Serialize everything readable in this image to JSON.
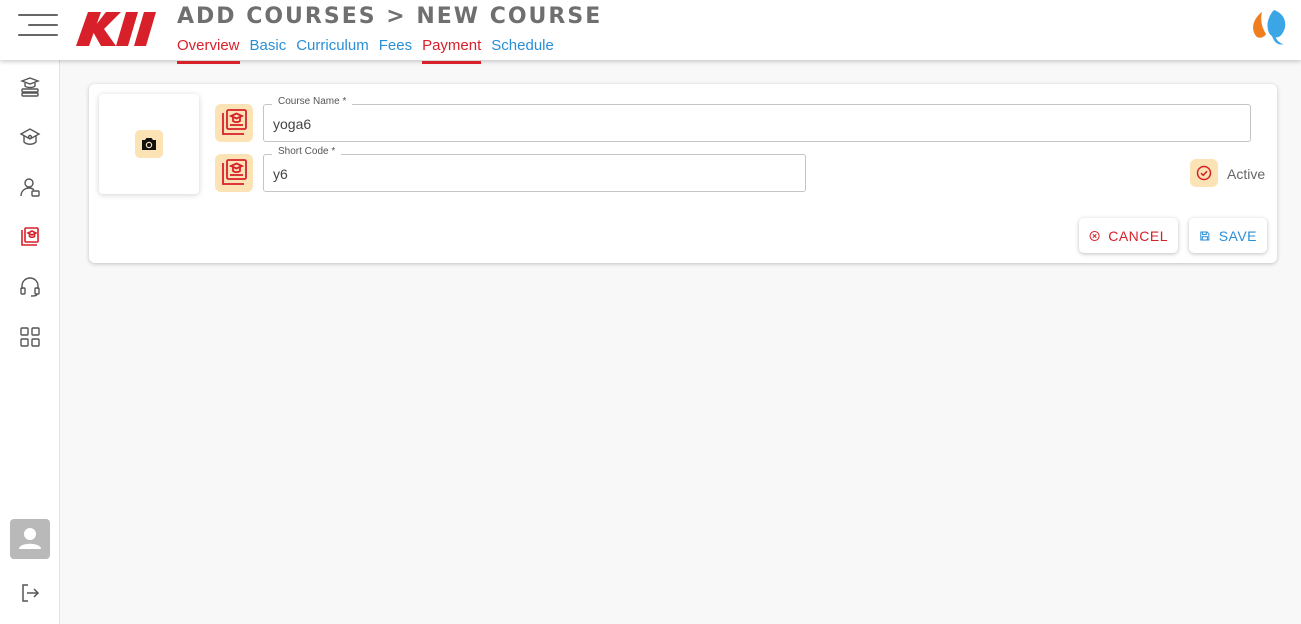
{
  "header": {
    "title": "ADD COURSES > NEW COURSE",
    "tabs": [
      {
        "label": "Overview",
        "active": true
      },
      {
        "label": "Basic",
        "active": false
      },
      {
        "label": "Curriculum",
        "active": false
      },
      {
        "label": "Fees",
        "active": false
      },
      {
        "label": "Payment",
        "active": true
      },
      {
        "label": "Schedule",
        "active": false
      }
    ]
  },
  "sidebar": {
    "items": [
      {
        "icon": "books-icon"
      },
      {
        "icon": "school-icon"
      },
      {
        "icon": "user-profile-icon"
      },
      {
        "icon": "courses-icon",
        "active": true
      },
      {
        "icon": "headset-icon"
      },
      {
        "icon": "apps-grid-icon"
      }
    ],
    "bottom": [
      {
        "icon": "avatar-icon"
      },
      {
        "icon": "logout-icon"
      }
    ]
  },
  "form": {
    "course_name": {
      "label": "Course Name *",
      "value": "yoga6"
    },
    "short_code": {
      "label": "Short Code *",
      "value": "y6"
    },
    "active_label": "Active",
    "cancel_label": "CANCEL",
    "save_label": "SAVE"
  },
  "colors": {
    "accent_red": "#d8202a",
    "link_blue": "#2a8fd6",
    "icon_badge": "#fbe3b5"
  }
}
